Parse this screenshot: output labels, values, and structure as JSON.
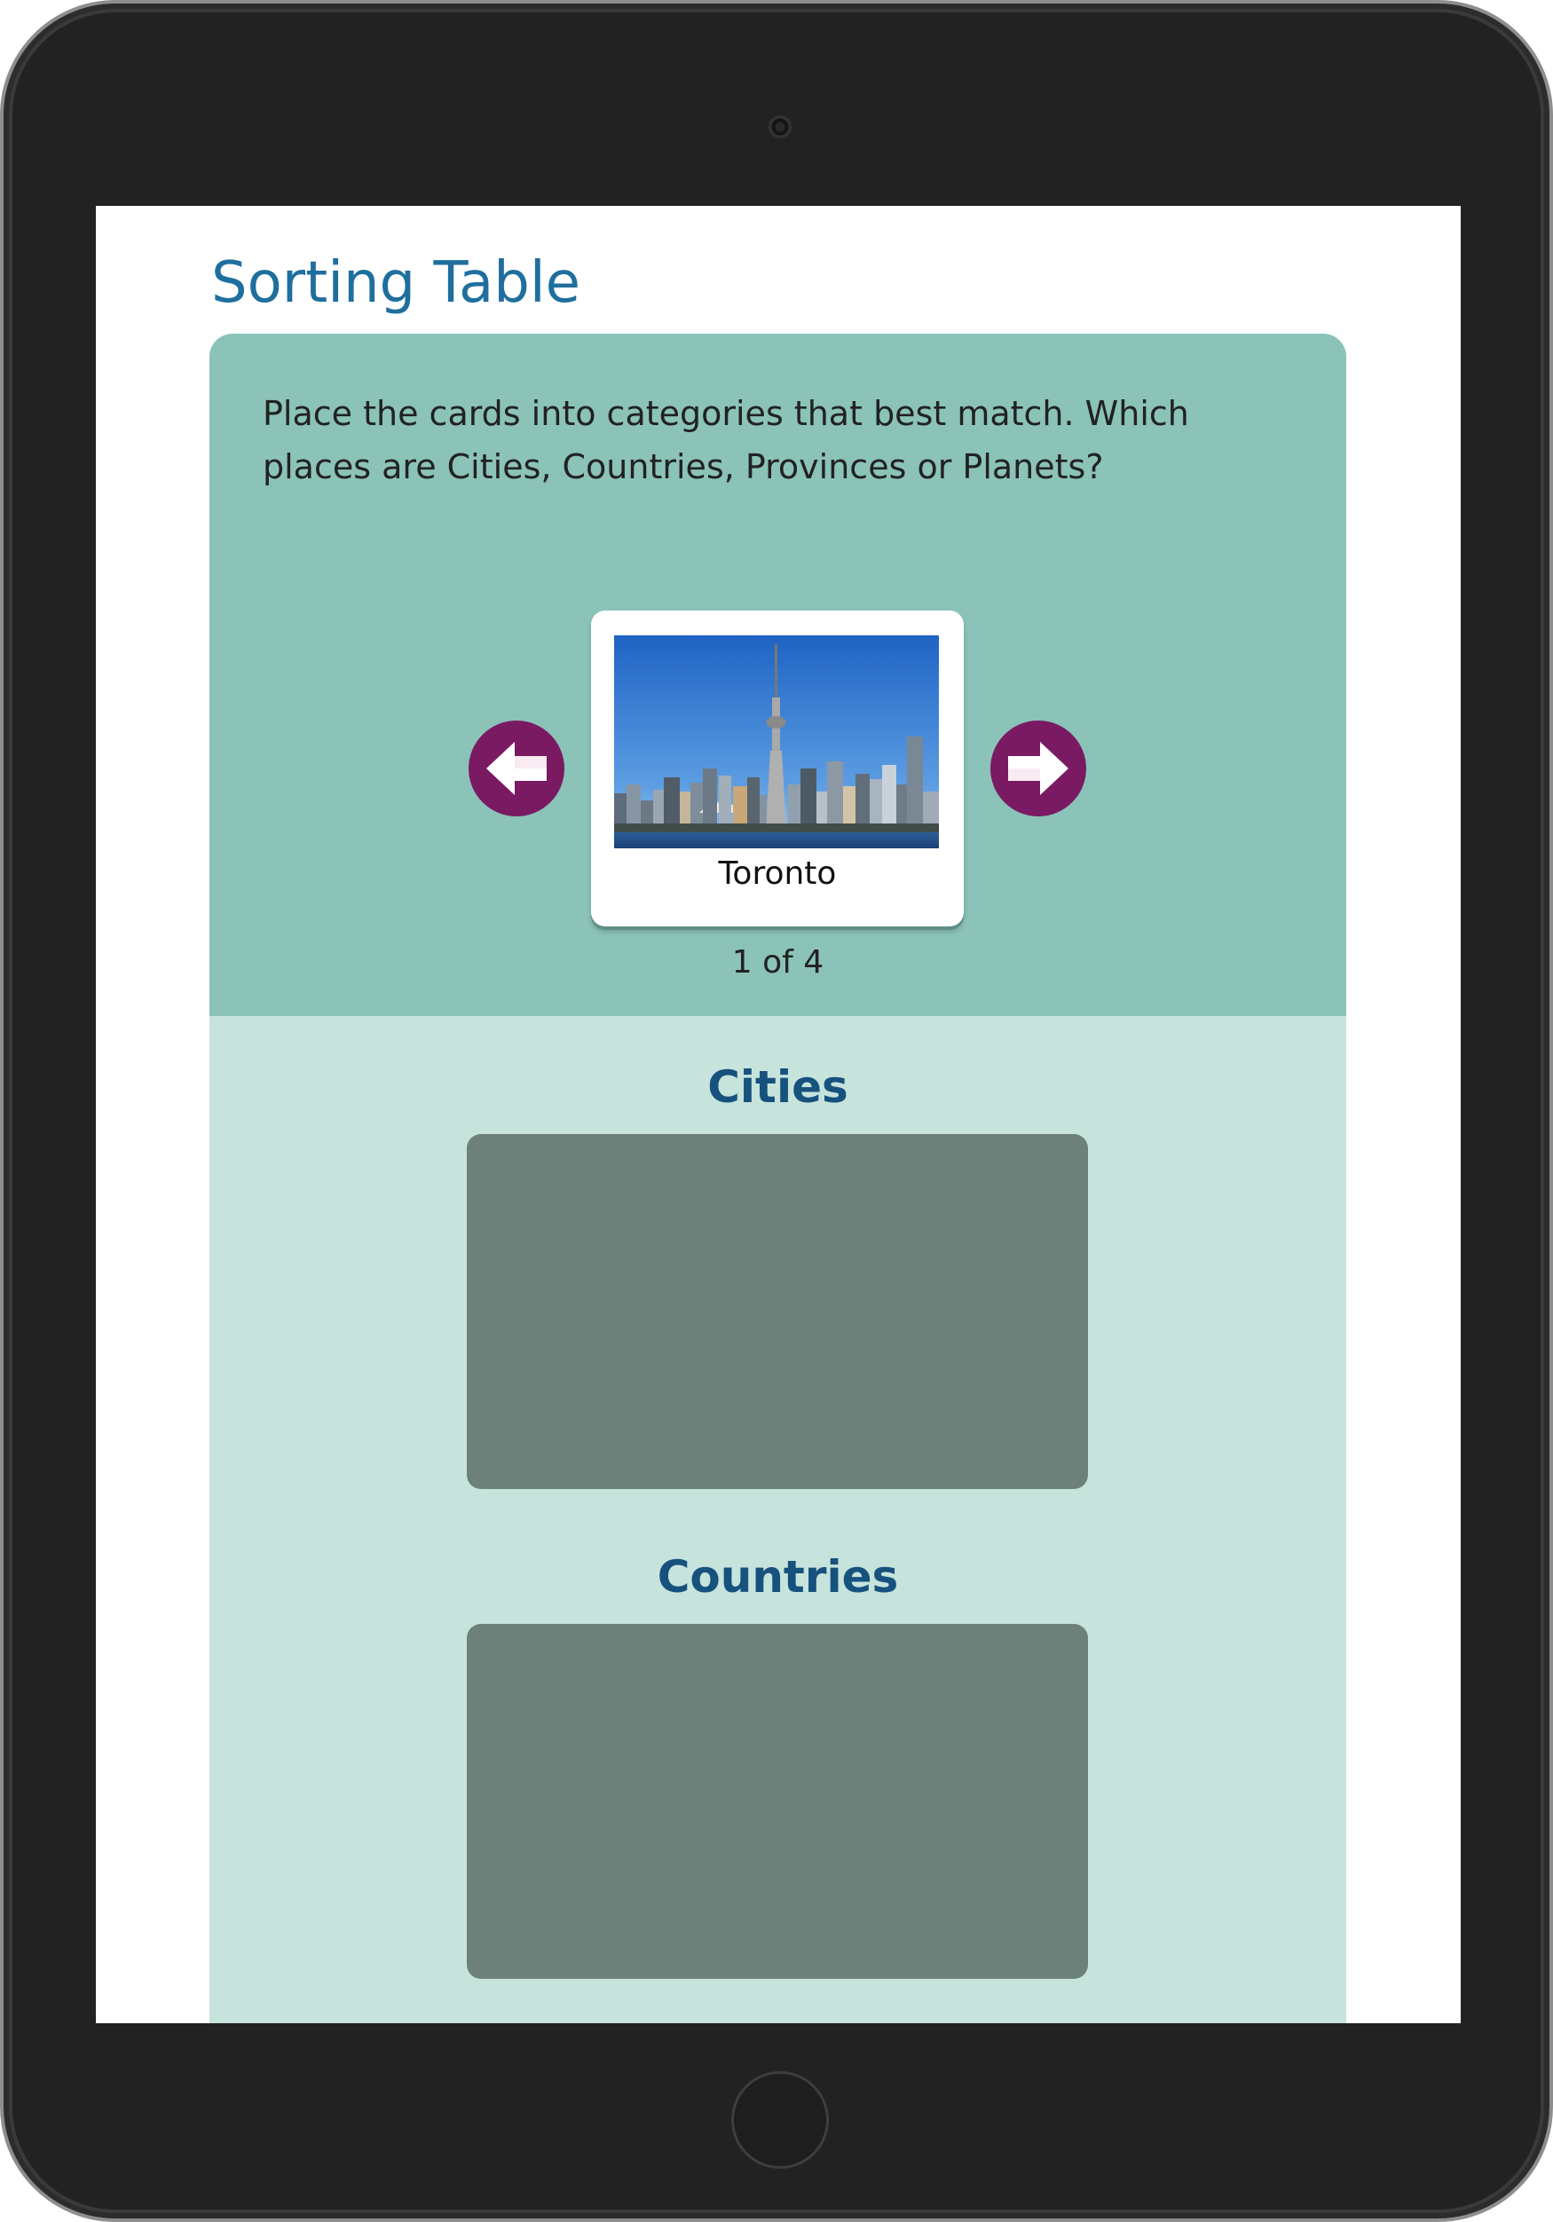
{
  "page": {
    "title": "Sorting Table"
  },
  "activity": {
    "instructions": "Place the cards into categories that best match. Which places are Cities, Countries, Provinces or Planets?",
    "prev_icon": "arrow-left-icon",
    "next_icon": "arrow-right-icon",
    "card": {
      "label": "Toronto",
      "image": "toronto-skyline-photo"
    },
    "page_indicator": "1 of 4",
    "categories": [
      {
        "title": "Cities"
      },
      {
        "title": "Countries"
      }
    ]
  },
  "colors": {
    "title": "#1f6f9e",
    "panel": "#8bc3b8",
    "category_area": "#c6e3dc",
    "drop_zone": "#6e807a",
    "arrow": "#7a1a63",
    "category_title": "#17517d"
  }
}
